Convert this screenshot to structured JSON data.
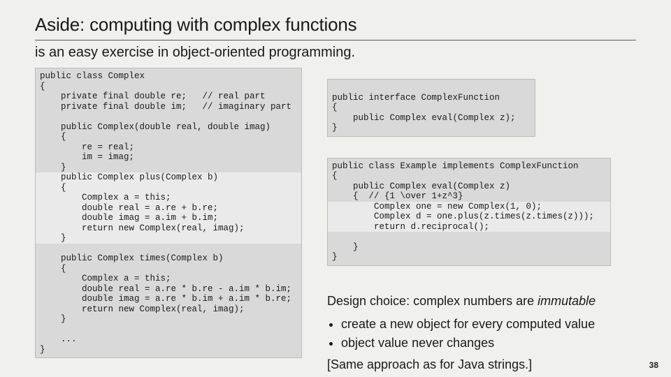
{
  "title": "Aside: computing with complex functions",
  "subtitle": "is an easy exercise in object-oriented programming.",
  "code_complex_head": "public class Complex\n{\n    private final double re;   // real part\n    private final double im;   // imaginary part\n\n    public Complex(double real, double imag)\n    {\n        re = real;\n        im = imag;\n    }",
  "code_complex_plus": "    public Complex plus(Complex b)\n    {\n        Complex a = this;\n        double real = a.re + b.re;\n        double imag = a.im + b.im;\n        return new Complex(real, imag);\n    }",
  "code_complex_tail": "\n    public Complex times(Complex b)\n    {\n        Complex a = this;\n        double real = a.re * b.re - a.im * b.im;\n        double imag = a.re * b.im + a.im * b.re;\n        return new Complex(real, imag);\n    }\n\n    ...\n}",
  "code_interface": "public interface ComplexFunction\n{\n    public Complex eval(Complex z);\n}",
  "code_example_head": "public class Example implements ComplexFunction\n{\n    public Complex eval(Complex z)\n    {  // {1 \\over 1+z^3}",
  "code_example_hl": "        Complex one = new Complex(1, 0);\n        Complex d = one.plus(z.times(z.times(z)));\n        return d.reciprocal();",
  "code_example_tail": "    }\n}",
  "design_lead_a": "Design choice: complex numbers are ",
  "design_lead_b": "immutable",
  "design_b1": "create a new object for every computed value",
  "design_b2": "object value never changes",
  "design_note": "[Same approach as for Java strings.]",
  "slide_number": "38"
}
